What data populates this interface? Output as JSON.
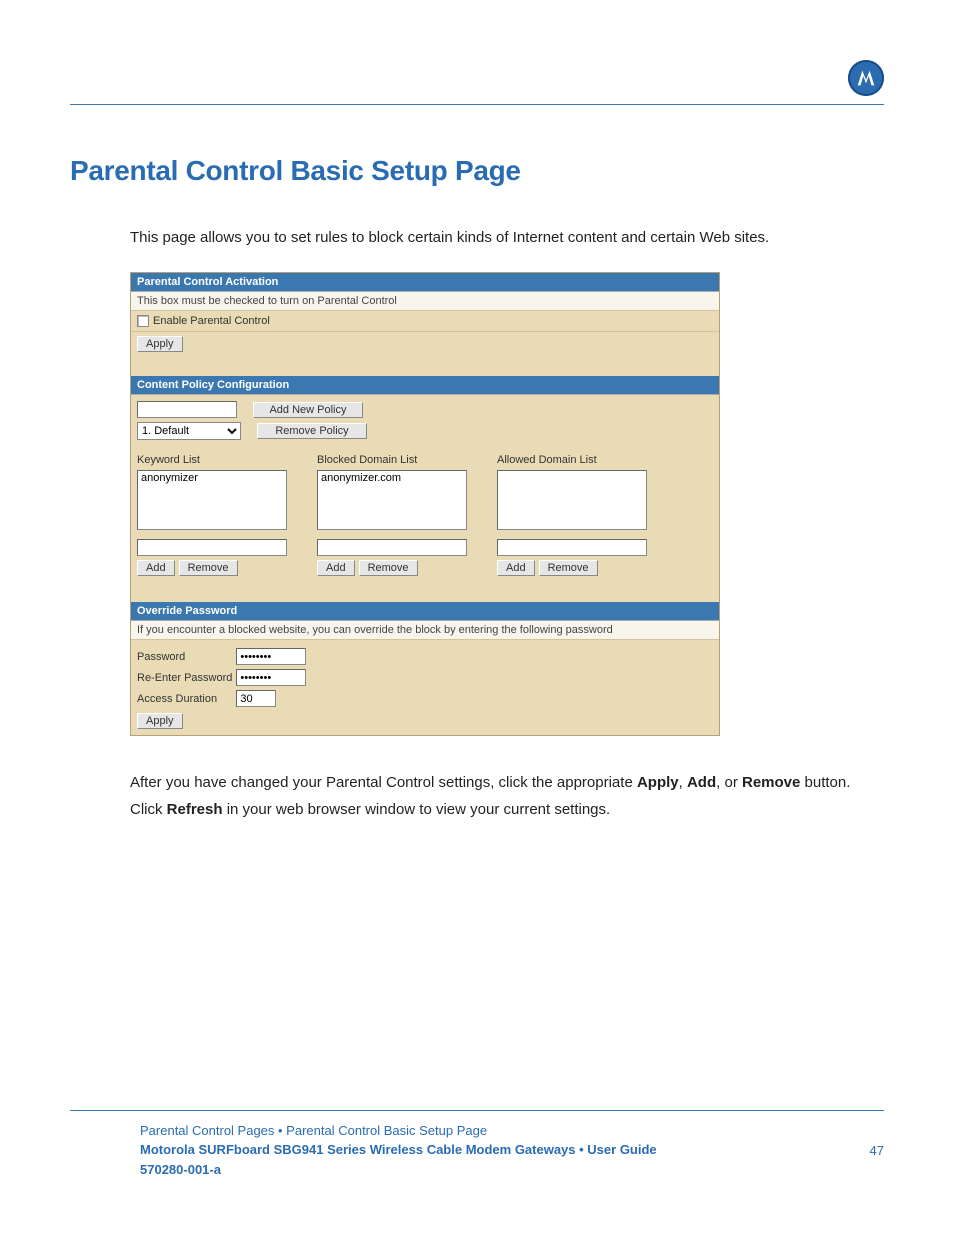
{
  "header": {
    "logo_name": "motorola-logo"
  },
  "title": "Parental Control Basic Setup Page",
  "intro": "This page allows you to set rules to block certain kinds of Internet content and certain Web sites.",
  "panel": {
    "activation": {
      "header": "Parental Control Activation",
      "desc": "This box must be checked to turn on Parental Control",
      "checkbox_label": "Enable Parental Control",
      "apply": "Apply"
    },
    "policy": {
      "header": "Content Policy Configuration",
      "add_btn": "Add New Policy",
      "remove_btn": "Remove Policy",
      "select_value": "1. Default",
      "keyword_label": "Keyword List",
      "keyword_items": "anonymizer",
      "blocked_label": "Blocked Domain List",
      "blocked_items": "anonymizer.com",
      "allowed_label": "Allowed Domain List",
      "allowed_items": "",
      "add": "Add",
      "remove": "Remove"
    },
    "override": {
      "header": "Override Password",
      "desc": "If you encounter a blocked website, you can override the block by entering the following password",
      "pw_label": "Password",
      "pw2_label": "Re-Enter Password",
      "dur_label": "Access Duration",
      "dur_value": "30",
      "pw_mask": "••••••••",
      "apply": "Apply"
    }
  },
  "outro": {
    "line1_a": "After you have changed your Parental Control settings, click the appropriate ",
    "apply": "Apply",
    "comma": ", ",
    "add": "Add",
    "or": ", or ",
    "remove": "Remove",
    "line1_b": " button.",
    "line2_a": "Click ",
    "refresh": "Refresh",
    "line2_b": " in your web browser window to view your current settings."
  },
  "footer": {
    "breadcrumb": "Parental Control Pages • Parental Control Basic Setup Page",
    "guide": "Motorola SURFboard SBG941 Series Wireless Cable Modem Gateways • User Guide",
    "docnum": "570280-001-a",
    "page": "47"
  }
}
